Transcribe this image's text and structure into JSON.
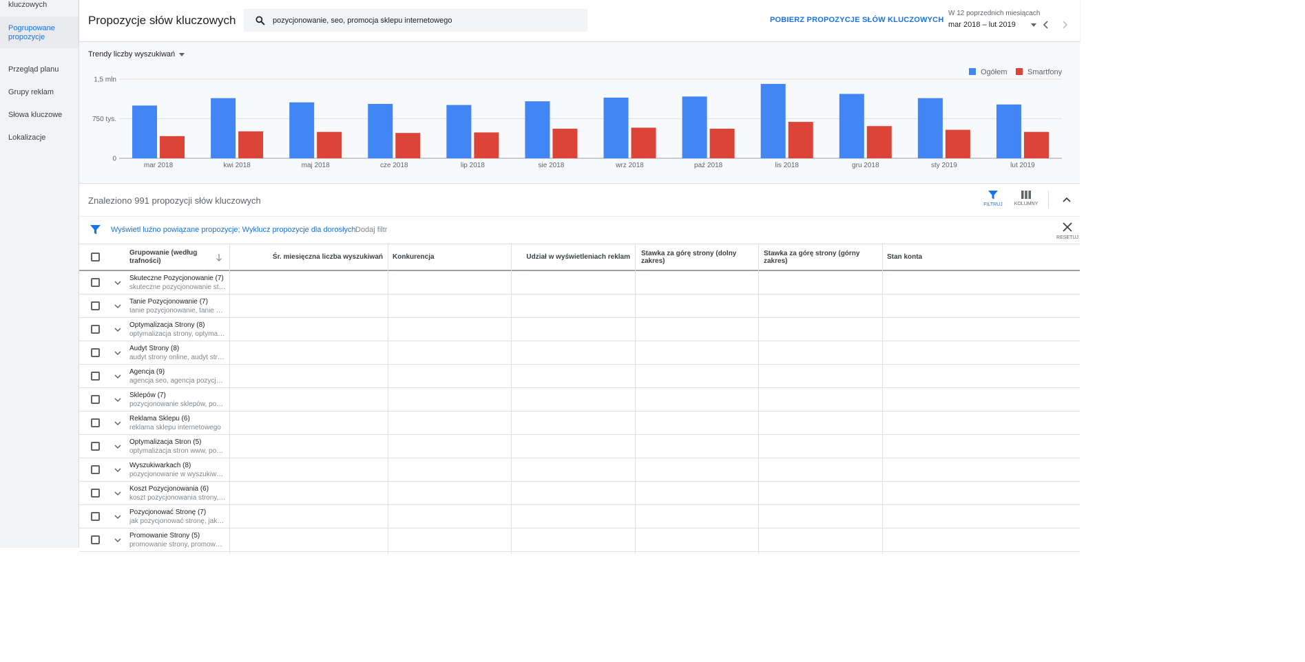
{
  "sidebar": {
    "items": [
      {
        "label": "kluczowych",
        "active": false
      },
      {
        "label": "Pogrupowane propozycje",
        "active": true
      },
      {
        "label": "Przegląd planu",
        "active": false
      },
      {
        "label": "Grupy reklam",
        "active": false
      },
      {
        "label": "Słowa kluczowe",
        "active": false
      },
      {
        "label": "Lokalizacje",
        "active": false
      }
    ]
  },
  "header": {
    "title": "Propozycje słów kluczowych",
    "search_value": "pozycjonowanie, seo, promocja sklepu internetowego",
    "download_label": "POBIERZ PROPOZYCJE SŁÓW KLUCZOWYCH",
    "range_label": "W 12 poprzednich miesiącach",
    "range_value": "mar 2018 – lut 2019"
  },
  "chart_controls": {
    "metric_select": "Trendy liczby wyszukiwań"
  },
  "chart_data": {
    "type": "bar",
    "categories": [
      "mar 2018",
      "kwi 2018",
      "maj 2018",
      "cze 2018",
      "lip 2018",
      "sie 2018",
      "wrz 2018",
      "paź 2018",
      "lis 2018",
      "gru 2018",
      "sty 2019",
      "lut 2019"
    ],
    "series": [
      {
        "name": "Ogółem",
        "color": "#4285f4",
        "values": [
          1000000,
          1140000,
          1060000,
          1030000,
          1010000,
          1080000,
          1150000,
          1170000,
          1410000,
          1220000,
          1140000,
          1020000
        ]
      },
      {
        "name": "Smartfony",
        "color": "#db4437",
        "values": [
          420000,
          510000,
          500000,
          480000,
          490000,
          560000,
          580000,
          560000,
          690000,
          610000,
          540000,
          500000
        ]
      }
    ],
    "yticks": [
      {
        "value": 0,
        "label": "0"
      },
      {
        "value": 750000,
        "label": "750 tys."
      },
      {
        "value": 1500000,
        "label": "1,5 mln"
      }
    ],
    "ylim": [
      0,
      1500000
    ],
    "legend_position": "top-right"
  },
  "results": {
    "title": "Znaleziono 991 propozycji słów kluczowych",
    "filter_label": "FILTRUJ",
    "columns_label": "KOLUMNY"
  },
  "filters": {
    "active": "Wyświetl luźno powiązane propozycje; Wyklucz propozycje dla dorosłych",
    "add": "Dodaj filtr",
    "reset": "RESETUJ"
  },
  "table": {
    "headers": [
      "Grupowanie (według trafności)",
      "Śr. miesięczna liczba wyszukiwań",
      "Konkurencja",
      "Udział w wyświetleniach reklam",
      "Stawka za górę strony (dolny zakres)",
      "Stawka za górę strony (górny zakres)",
      "Stan konta"
    ],
    "rows": [
      {
        "title": "Skuteczne Pozycjonowanie (7)",
        "sub": "skuteczne pozycjonowanie stron"
      },
      {
        "title": "Tanie Pozycjonowanie (7)",
        "sub": "tanie pozycjonowanie, tanie pozycjonowanie stron"
      },
      {
        "title": "Optymalizacja Strony (8)",
        "sub": "optymalizacja strony, optymalizacja strony www"
      },
      {
        "title": "Audyt Strony (8)",
        "sub": "audyt strony online, audyt strony www"
      },
      {
        "title": "Agencja (9)",
        "sub": "agencja seo, agencja pozycjonowania"
      },
      {
        "title": "Sklepów (7)",
        "sub": "pozycjonowanie sklepów, pozycjonowanie sklepów internetowych"
      },
      {
        "title": "Reklama Sklepu (6)",
        "sub": "reklama sklepu internetowego"
      },
      {
        "title": "Optymalizacja Stron (5)",
        "sub": "optymalizacja stron www, pozycjonowanie"
      },
      {
        "title": "Wyszukiwarkach (8)",
        "sub": "pozycjonowanie w wyszukiwarkach"
      },
      {
        "title": "Koszt Pozycjonowania (6)",
        "sub": "koszt pozycjonowania strony, cena"
      },
      {
        "title": "Pozycjonować Stronę (7)",
        "sub": "jak pozycjonować stronę, jak pozycjonować"
      },
      {
        "title": "Promowanie Strony (5)",
        "sub": "promowanie strony, promowanie strony www"
      }
    ]
  }
}
